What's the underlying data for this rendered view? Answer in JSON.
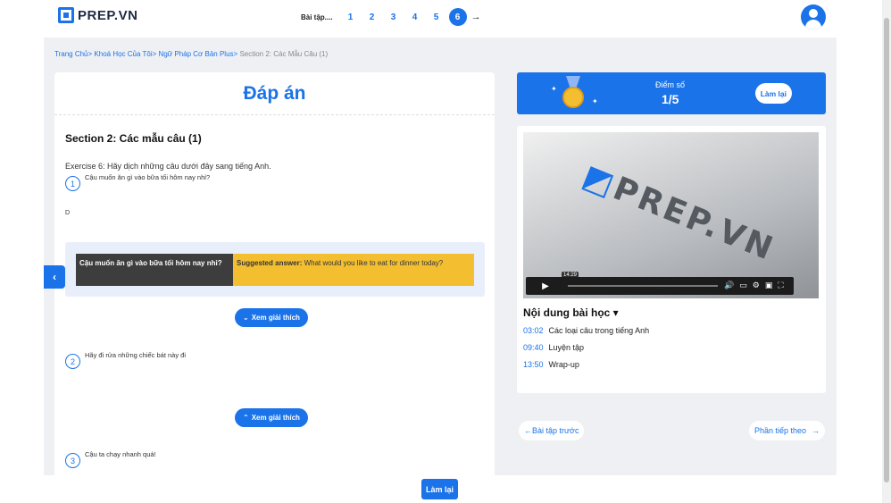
{
  "header": {
    "logo_text": "PREP.VN",
    "exercise_label": "Bài tập",
    "tabs": [
      "1",
      "2",
      "3",
      "4",
      "5",
      "6"
    ],
    "active_tab": "6",
    "next_arrow": "→"
  },
  "breadcrumb": {
    "items": [
      "Trang Chủ>",
      "Khoá Học Của Tôi>",
      "Ngữ Pháp Cơ Bản Plus>"
    ],
    "current": "Section 2: Các Mẫu Câu (1)"
  },
  "answer": {
    "title": "Đáp án",
    "section_title": "Section 2: Các mẫu câu (1)",
    "exercise_instruction": "Exercise 6: Hãy dịch những câu dưới đây sang tiếng Anh.",
    "questions": [
      {
        "number": "1",
        "text": "Cậu muốn ăn gì vào bữa tối hôm nay nhỉ?",
        "user_answer": "D"
      },
      {
        "number": "2",
        "text": "Hãy đi rửa những chiếc bát này đi"
      },
      {
        "number": "3",
        "text": "Cậu ta chạy nhanh quá!"
      }
    ],
    "compare": {
      "source": "Cậu muốn ăn gì vào bữa tối hôm nay nhỉ?",
      "suggested_label": "Suggested answer:",
      "suggested_text": "What would you like to eat for dinner today?"
    },
    "explain_buttons": [
      "Xem giải thích",
      "Xem giải thích"
    ]
  },
  "score": {
    "label": "Điểm số",
    "value": "1/5",
    "retry_label": "Làm lại"
  },
  "video": {
    "brand_text": "PREP.VN",
    "tooltip_time": "14:29"
  },
  "toc": {
    "title": "Nội dung bài học",
    "items": [
      {
        "time": "03:02",
        "label": "Các loại câu trong tiếng Anh"
      },
      {
        "time": "09:40",
        "label": "Luyện tập"
      },
      {
        "time": "13:50",
        "label": "Wrap-up"
      }
    ]
  },
  "navigation": {
    "prev_label": "Bài tập trước",
    "next_label": "Phần tiếp theo"
  },
  "footer": {
    "retry_label": "Làm lại"
  },
  "colors": {
    "primary": "#1a73e8",
    "highlight": "#f3bf31",
    "dark_cell": "#3d3d3d",
    "background": "#eef0f4"
  }
}
